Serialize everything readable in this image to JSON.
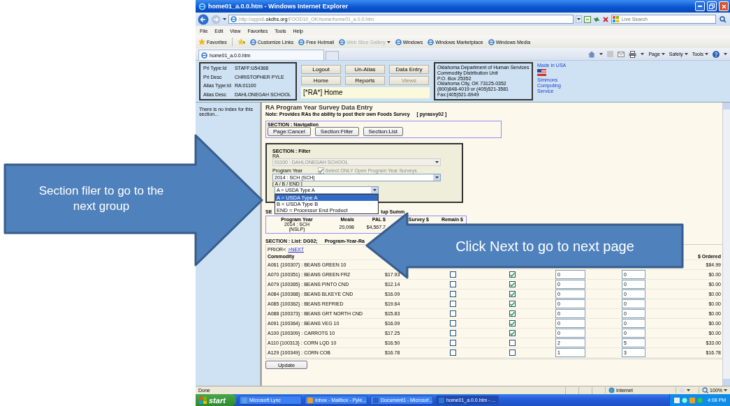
{
  "window": {
    "title": "home01_a.0.0.htm - Windows Internet Explorer"
  },
  "address_bar": {
    "url": "http://apps6.**okdhs.org**/FOOD10_OK/home/home01_a.0.0.htm",
    "search_placeholder": "Live Search"
  },
  "menu": [
    "File",
    "Edit",
    "View",
    "Favorites",
    "Tools",
    "Help"
  ],
  "favorites_bar": {
    "label": "Favorites",
    "links": [
      {
        "label": "Customize Links",
        "disabled": false,
        "has_menu": false
      },
      {
        "label": "Free Hotmail",
        "disabled": false,
        "has_menu": false
      },
      {
        "label": "Web Slice Gallery",
        "disabled": true,
        "has_menu": true
      },
      {
        "label": "Windows",
        "disabled": false,
        "has_menu": false
      },
      {
        "label": "Windows Marketplace",
        "disabled": false,
        "has_menu": false
      },
      {
        "label": "Windows Media",
        "disabled": false,
        "has_menu": false
      }
    ]
  },
  "tabs": [
    {
      "label": "home01_a.0.0.htm",
      "selected": true
    }
  ],
  "command_bar": [
    "Page",
    "Safety",
    "Tools"
  ],
  "header": {
    "user_info": [
      {
        "label": "Pri Type:Id",
        "value": "STAFF:U54368"
      },
      {
        "label": "Pri Desc",
        "value": "CHRISTOPHER PYLE"
      },
      {
        "label": "Alias Type:Id",
        "value": "RA:01100"
      },
      {
        "label": "Alias Desc",
        "value": "DAHLONEGAH SCHOOL"
      }
    ],
    "buttons": [
      {
        "label": "Logout",
        "disabled": false
      },
      {
        "label": "Un-Alias",
        "disabled": false
      },
      {
        "label": "Data Entry",
        "disabled": false
      },
      {
        "label": "Home",
        "disabled": false
      },
      {
        "label": "Reports",
        "disabled": false
      },
      {
        "label": "Views",
        "disabled": true
      }
    ],
    "page_label": "[*RA*] Home",
    "contact": [
      "Oklahoma Department of Human Services",
      "Commodity Distribution Unit",
      "P.O. Box 25352",
      "Oklahoma City, OK 73125-0352",
      "(800)848-4019 or (405)521-3581",
      "Fax:(405)521-6949"
    ],
    "made_in": "Made in USA",
    "vendor": "Simmons Computing Service"
  },
  "sidebar": {
    "text": "There is no Index for this section..."
  },
  "page": {
    "title": "RA Program Year Survey Data Entry",
    "note": "Note: Provides RAs the ability to post their own Foods Survey",
    "code": "[ pyrasvy02 ]"
  },
  "navigation": {
    "title": "SECTION : Navigation",
    "buttons": [
      "Page:Cancel",
      "Section:Filter",
      "Section:List"
    ]
  },
  "filter": {
    "title": "SECTION : Filter",
    "ra_label": "RA",
    "ra_value": "01100 : DAHLONEGAH SCHOOL",
    "ra_disabled": true,
    "year_label": "Program Year",
    "open_only": {
      "label": "Select ONLY Open Program Year Surveys",
      "checked": true,
      "disabled": true
    },
    "year_value": "2014 : SCH (SCH)",
    "type_label": "[ A / B / END ]",
    "type_value": "A = USDA Type A",
    "type_options": [
      {
        "label": "A = USDA Type A",
        "selected": true
      },
      {
        "label": "B = USDA Type B",
        "selected": false
      },
      {
        "label": "END = Processor End Product",
        "selected": false
      }
    ]
  },
  "summary": {
    "title_parts": [
      "SE",
      "lup Summ"
    ],
    "columns": [
      "Program Year",
      "Meals",
      "PAL $",
      "Survey $",
      "Remain $"
    ],
    "row": [
      "2014 : SCH (NSLP)",
      "20,098",
      "$4,567.7"
    ]
  },
  "list": {
    "title": "SECTION : List: DG02;",
    "subtitle": "Program-Year-Ra",
    "prior": "PRIOR<",
    "next": ">NEXT",
    "columns": {
      "commodity": "Commodity",
      "ordered": "$ Ordered"
    },
    "rows": [
      {
        "commodity": "A061 {100307} : BEANS GREEN 10",
        "ordered": "$84.99"
      },
      {
        "commodity": "A070 {100351} : BEANS GREEN FRZ",
        "price": "$17.93",
        "type_a": false,
        "type_b": true,
        "qty_1": "0",
        "qty_2": "0",
        "ordered": "$0.00"
      },
      {
        "commodity": "A079 {100365} : BEANS PINTO CND",
        "price": "$12.14",
        "type_a": false,
        "type_b": true,
        "qty_1": "0",
        "qty_2": "0",
        "ordered": "$0.00"
      },
      {
        "commodity": "A084 {100368} : BEANS BLKEYE CND",
        "price": "$16.09",
        "type_a": false,
        "type_b": true,
        "qty_1": "0",
        "qty_2": "0",
        "ordered": "$0.00"
      },
      {
        "commodity": "A085 {100362} : BEANS REFRIED",
        "price": "$19.64",
        "type_a": false,
        "type_b": true,
        "qty_1": "0",
        "qty_2": "0",
        "ordered": "$0.00"
      },
      {
        "commodity": "A088 {100373} : BEANS GRT NORTH CND",
        "price": "$15.83",
        "type_a": false,
        "type_b": true,
        "qty_1": "0",
        "qty_2": "0",
        "ordered": "$0.00"
      },
      {
        "commodity": "A091 {100364} : BEANS VEG 10",
        "price": "$16.09",
        "type_a": false,
        "type_b": true,
        "qty_1": "0",
        "qty_2": "0",
        "ordered": "$0.00"
      },
      {
        "commodity": "A100 {100309} : CARROTS 10",
        "price": "$17.25",
        "type_a": false,
        "type_b": true,
        "qty_1": "0",
        "qty_2": "0",
        "ordered": "$0.00"
      },
      {
        "commodity": "A110 {100313} : CORN LQD 10",
        "price": "$16.50",
        "type_a": false,
        "type_b": false,
        "qty_1": "2",
        "qty_2": "5",
        "ordered": "$33.00"
      },
      {
        "commodity": "A129 {100349} : CORN COB",
        "price": "$16.78",
        "type_a": false,
        "type_b": false,
        "qty_1": "1",
        "qty_2": "3",
        "ordered": "$16.78"
      }
    ],
    "update": "Update"
  },
  "status_bar": {
    "text": "Done",
    "zone": "Internet",
    "zoom": "100%"
  },
  "taskbar": {
    "start": "start",
    "items": [
      {
        "label": "Microsoft Lync",
        "selected": false
      },
      {
        "label": "Inbox - Mailbox - Pyle...",
        "selected": false
      },
      {
        "label": "Document1 - Microsof...",
        "selected": false
      },
      {
        "label": "home01_a.0.0.htm - ...",
        "selected": true
      }
    ],
    "clock": "4:08 PM"
  },
  "callouts": [
    {
      "text": "Section filer to go to the next group"
    },
    {
      "text": "Click Next to go to next page"
    }
  ]
}
